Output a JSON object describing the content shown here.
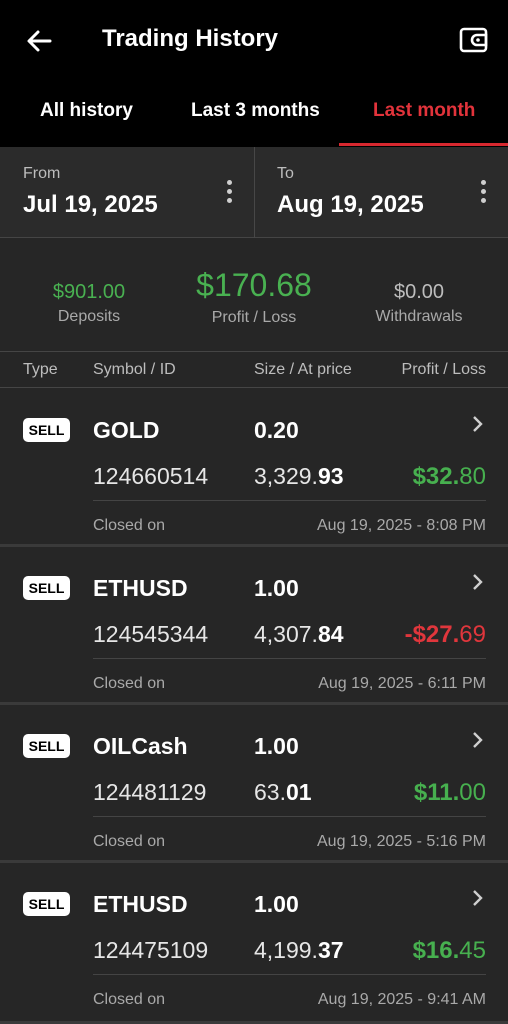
{
  "header": {
    "title": "Trading History",
    "back_icon": "arrow-left-icon",
    "wallet_icon": "wallet-icon"
  },
  "tabs": [
    {
      "label": "All history",
      "active": false
    },
    {
      "label": "Last 3 months",
      "active": false
    },
    {
      "label": "Last month",
      "active": true
    }
  ],
  "range": {
    "from_label": "From",
    "from_value": "Jul 19, 2025",
    "to_label": "To",
    "to_value": "Aug 19, 2025"
  },
  "summary": {
    "deposits_value": "$901.00",
    "deposits_label": "Deposits",
    "pl_value": "$170.68",
    "pl_label": "Profit / Loss",
    "withdrawals_value": "$0.00",
    "withdrawals_label": "Withdrawals"
  },
  "columns": {
    "type": "Type",
    "symbol": "Symbol / ID",
    "size": "Size / At price",
    "pl": "Profit / Loss"
  },
  "colors": {
    "accent": "#e2333b",
    "profit": "#47b04f",
    "loss": "#e0363c"
  },
  "trades": [
    {
      "type": "SELL",
      "symbol": "GOLD",
      "size": "0.20",
      "id": "124660514",
      "price_int": "3,329.",
      "price_dec": "93",
      "pl_sign": "pos",
      "pl_int": "$32.",
      "pl_dec": "80",
      "closed_label": "Closed on",
      "closed_at": "Aug 19, 2025 - 8:08 PM"
    },
    {
      "type": "SELL",
      "symbol": "ETHUSD",
      "size": "1.00",
      "id": "124545344",
      "price_int": "4,307.",
      "price_dec": "84",
      "pl_sign": "neg",
      "pl_int": "-$27.",
      "pl_dec": "69",
      "closed_label": "Closed on",
      "closed_at": "Aug 19, 2025 - 6:11 PM"
    },
    {
      "type": "SELL",
      "symbol": "OILCash",
      "size": "1.00",
      "id": "124481129",
      "price_int": "63.",
      "price_dec": "01",
      "pl_sign": "pos",
      "pl_int": "$11.",
      "pl_dec": "00",
      "closed_label": "Closed on",
      "closed_at": "Aug 19, 2025 - 5:16 PM"
    },
    {
      "type": "SELL",
      "symbol": "ETHUSD",
      "size": "1.00",
      "id": "124475109",
      "price_int": "4,199.",
      "price_dec": "37",
      "pl_sign": "pos",
      "pl_int": "$16.",
      "pl_dec": "45",
      "closed_label": "Closed on",
      "closed_at": "Aug 19, 2025 - 9:41 AM"
    }
  ]
}
